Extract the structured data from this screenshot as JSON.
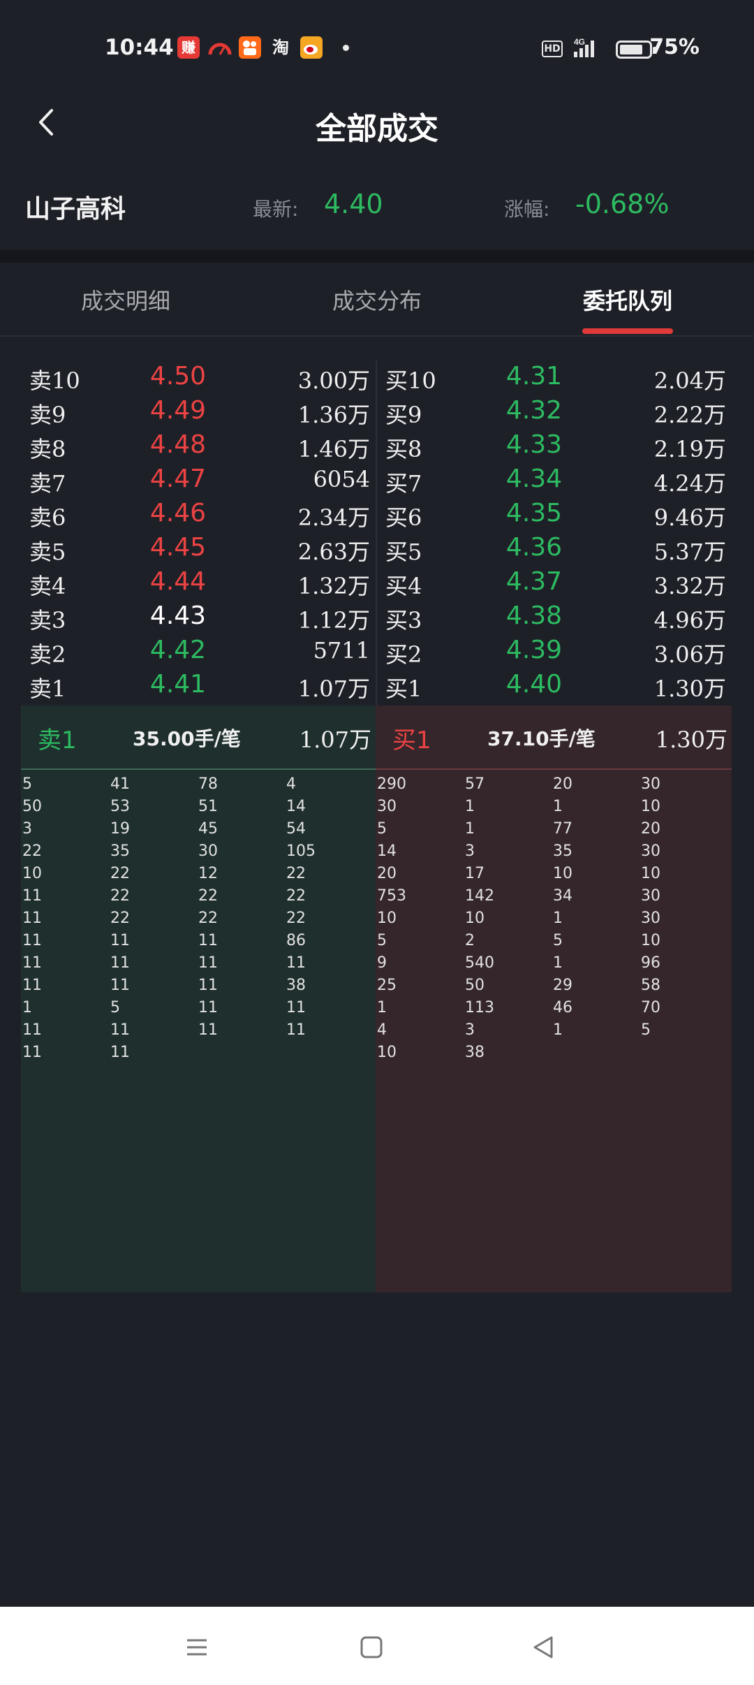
{
  "status_bar": {
    "time": "10:44",
    "battery": "75%",
    "network": "4G",
    "hd": "HD",
    "app_icons": [
      "earn-app-icon",
      "speedometer-app-icon",
      "kuaishou-app-icon",
      "taobao-app-icon",
      "weibo-app-icon"
    ],
    "taobao_glyph": "淘",
    "earn_glyph": "赚"
  },
  "header": {
    "title": "全部成交"
  },
  "quote": {
    "stock_name": "山子高科",
    "latest_label": "最新:",
    "latest_value": "4.40",
    "change_label": "涨幅:",
    "change_value": "-0.68%"
  },
  "tabs": [
    {
      "label": "成交明细",
      "active": false
    },
    {
      "label": "成交分布",
      "active": false
    },
    {
      "label": "委托队列",
      "active": true
    }
  ],
  "sell_levels": [
    {
      "level": "卖10",
      "price": "4.50",
      "volume": "3.00万",
      "color": "red"
    },
    {
      "level": "卖9",
      "price": "4.49",
      "volume": "1.36万",
      "color": "red"
    },
    {
      "level": "卖8",
      "price": "4.48",
      "volume": "1.46万",
      "color": "red"
    },
    {
      "level": "卖7",
      "price": "4.47",
      "volume": "6054",
      "color": "red"
    },
    {
      "level": "卖6",
      "price": "4.46",
      "volume": "2.34万",
      "color": "red"
    },
    {
      "level": "卖5",
      "price": "4.45",
      "volume": "2.63万",
      "color": "red"
    },
    {
      "level": "卖4",
      "price": "4.44",
      "volume": "1.32万",
      "color": "red"
    },
    {
      "level": "卖3",
      "price": "4.43",
      "volume": "1.12万",
      "color": "white"
    },
    {
      "level": "卖2",
      "price": "4.42",
      "volume": "5711",
      "color": "green"
    },
    {
      "level": "卖1",
      "price": "4.41",
      "volume": "1.07万",
      "color": "green"
    }
  ],
  "buy_levels": [
    {
      "level": "买10",
      "price": "4.31",
      "volume": "2.04万",
      "color": "green"
    },
    {
      "level": "买9",
      "price": "4.32",
      "volume": "2.22万",
      "color": "green"
    },
    {
      "level": "买8",
      "price": "4.33",
      "volume": "2.19万",
      "color": "green"
    },
    {
      "level": "买7",
      "price": "4.34",
      "volume": "4.24万",
      "color": "green"
    },
    {
      "level": "买6",
      "price": "4.35",
      "volume": "9.46万",
      "color": "green"
    },
    {
      "level": "买5",
      "price": "4.36",
      "volume": "5.37万",
      "color": "green"
    },
    {
      "level": "买4",
      "price": "4.37",
      "volume": "3.32万",
      "color": "green"
    },
    {
      "level": "买3",
      "price": "4.38",
      "volume": "4.96万",
      "color": "green"
    },
    {
      "level": "买2",
      "price": "4.39",
      "volume": "3.06万",
      "color": "green"
    },
    {
      "level": "买1",
      "price": "4.40",
      "volume": "1.30万",
      "color": "green"
    }
  ],
  "sell_queue": {
    "label": "卖1",
    "avg": "35.00手/笔",
    "total": "1.07万",
    "rows": [
      [
        "5",
        "41",
        "78",
        "4"
      ],
      [
        "50",
        "53",
        "51",
        "14"
      ],
      [
        "3",
        "19",
        "45",
        "54"
      ],
      [
        "22",
        "35",
        "30",
        "105"
      ],
      [
        "10",
        "22",
        "12",
        "22"
      ],
      [
        "11",
        "22",
        "22",
        "22"
      ],
      [
        "11",
        "22",
        "22",
        "22"
      ],
      [
        "11",
        "11",
        "11",
        "86"
      ],
      [
        "11",
        "11",
        "11",
        "11"
      ],
      [
        "11",
        "11",
        "11",
        "38"
      ],
      [
        "1",
        "5",
        "11",
        "11"
      ],
      [
        "11",
        "11",
        "11",
        "11"
      ],
      [
        "11",
        "11"
      ]
    ]
  },
  "buy_queue": {
    "label": "买1",
    "avg": "37.10手/笔",
    "total": "1.30万",
    "rows": [
      [
        "290",
        "57",
        "20",
        "30"
      ],
      [
        "30",
        "1",
        "1",
        "10"
      ],
      [
        "5",
        "1",
        "77",
        "20"
      ],
      [
        "14",
        "3",
        "35",
        "30"
      ],
      [
        "20",
        "17",
        "10",
        "10"
      ],
      [
        "753",
        "142",
        "34",
        "30"
      ],
      [
        "10",
        "10",
        "1",
        "30"
      ],
      [
        "5",
        "2",
        "5",
        "10"
      ],
      [
        "9",
        "540",
        "1",
        "96"
      ],
      [
        "25",
        "50",
        "29",
        "58"
      ],
      [
        "1",
        "113",
        "46",
        "70"
      ],
      [
        "4",
        "3",
        "1",
        "5"
      ],
      [
        "10",
        "38"
      ]
    ]
  },
  "colors": {
    "background": "#1e2028",
    "red": "#ec4343",
    "green": "#2dbb61",
    "sell_queue_bg": "#1f2f2e",
    "buy_queue_bg": "#35262b",
    "tab_indicator": "#e03a3a"
  },
  "system_nav": [
    "menu-icon",
    "home-icon",
    "back-triangle-icon"
  ]
}
